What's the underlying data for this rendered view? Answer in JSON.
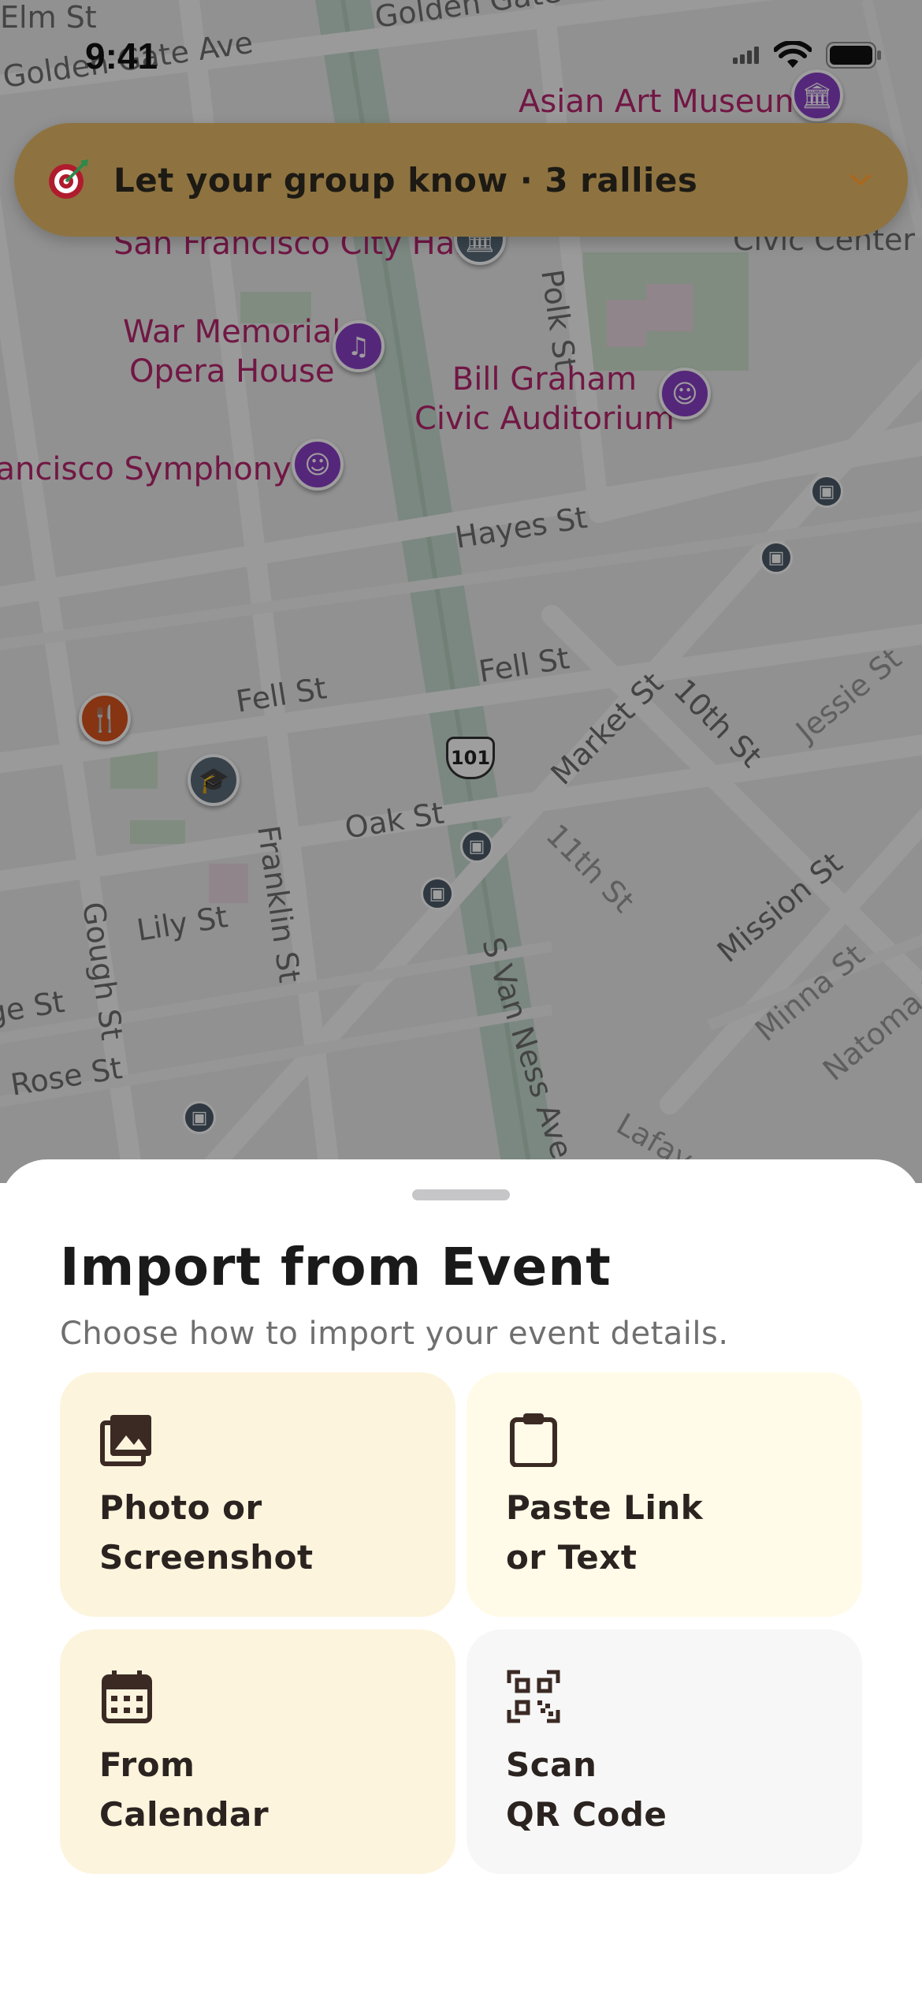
{
  "status_bar": {
    "time": "9:41"
  },
  "map": {
    "streets": [
      {
        "name": "Elm St"
      },
      {
        "name": "Golden Gate Ave"
      },
      {
        "name": "Golden Gate Ave (north)",
        "text": "Golden Gate Ave"
      },
      {
        "name": "Hayes St"
      },
      {
        "name": "Fell St"
      },
      {
        "name": "Fell St (east)",
        "text": "Fell St"
      },
      {
        "name": "Oak St"
      },
      {
        "name": "Lily St"
      },
      {
        "name": "Rose St"
      },
      {
        "name": "Page St"
      },
      {
        "name": "Franklin St"
      },
      {
        "name": "Gough St"
      },
      {
        "name": "S Van Ness Ave"
      },
      {
        "name": "Market St"
      },
      {
        "name": "10th St"
      },
      {
        "name": "11th St"
      },
      {
        "name": "Mission St"
      },
      {
        "name": "Minna St"
      },
      {
        "name": "Natoma St"
      },
      {
        "name": "Jessie St"
      },
      {
        "name": "Lafayette"
      },
      {
        "name": "Polk St"
      },
      {
        "name": "Civic Center"
      }
    ],
    "pois": {
      "asian_art_museum": "Asian Art Museum",
      "city_hall": "San Francisco City Hall",
      "war_memorial": "War Memorial\nOpera House",
      "bill_graham": "Bill Graham\nCivic Auditorium",
      "symphony": "San Francisco Symphony"
    },
    "highway_shield": "101"
  },
  "banner": {
    "text": "Let your group know · 3 rallies",
    "icon": "target-icon"
  },
  "sheet": {
    "title": "Import from Event",
    "subtitle": "Choose how to import your event details.",
    "options": [
      {
        "label": "Photo or\nScreenshot",
        "icon": "photo-icon"
      },
      {
        "label": "Paste Link\nor Text",
        "icon": "clipboard-icon"
      },
      {
        "label": "From\nCalendar",
        "icon": "calendar-icon"
      },
      {
        "label": "Scan\nQR Code",
        "icon": "qr-code-icon"
      }
    ]
  },
  "colors": {
    "banner_bg": "#8e7340",
    "poi_label": "#b6266f",
    "card_warm": "#fdf4dd",
    "card_neutral": "#f7f7f7"
  }
}
